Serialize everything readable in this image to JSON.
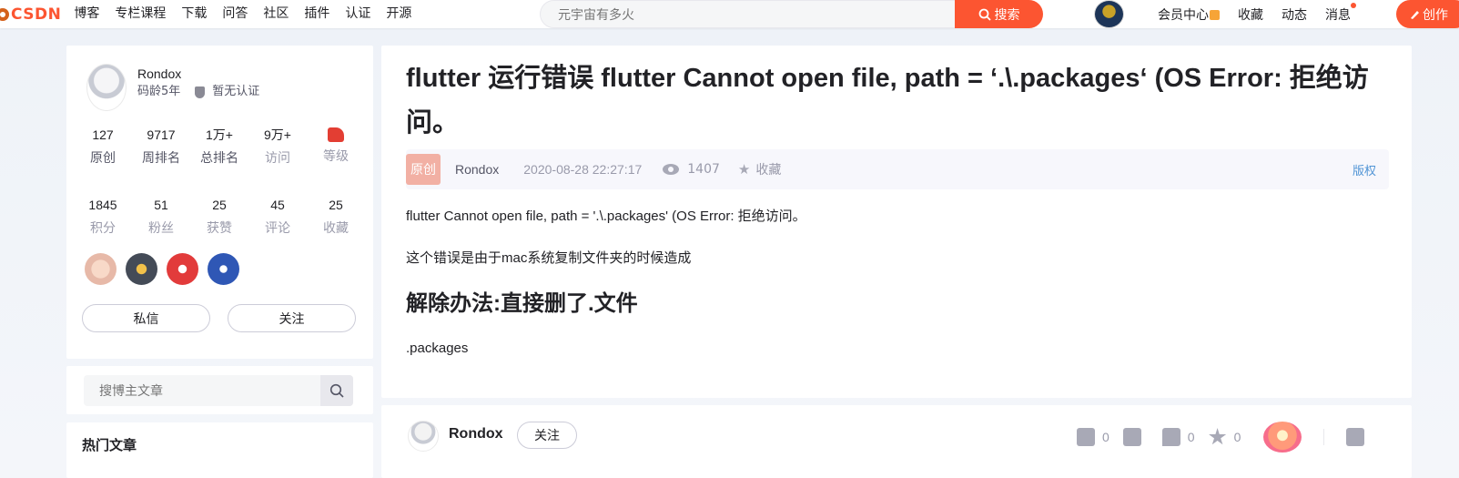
{
  "header": {
    "logo": "CSDN",
    "nav": [
      "博客",
      "专栏课程",
      "下载",
      "问答",
      "社区",
      "插件",
      "认证",
      "开源"
    ],
    "search_placeholder": "元宇宙有多火",
    "search_button": "搜索",
    "right_links": {
      "vip": "会员中心",
      "favorites": "收藏",
      "activity": "动态",
      "messages": "消息"
    },
    "create_button": "创作"
  },
  "profile": {
    "name": "Rondox",
    "age": "码龄5年",
    "cert": "暂无认证",
    "stats_row1": [
      {
        "num": "127",
        "label": "原创"
      },
      {
        "num": "9717",
        "label": "周排名"
      },
      {
        "num": "1万+",
        "label": "总排名"
      },
      {
        "num": "9万+",
        "label": "访问"
      },
      {
        "num": "",
        "label": "等级"
      }
    ],
    "stats_row2": [
      {
        "num": "1845",
        "label": "积分"
      },
      {
        "num": "51",
        "label": "粉丝"
      },
      {
        "num": "25",
        "label": "获赞"
      },
      {
        "num": "45",
        "label": "评论"
      },
      {
        "num": "25",
        "label": "收藏"
      }
    ],
    "message_button": "私信",
    "follow_button": "关注"
  },
  "blog_search": {
    "placeholder": "搜博主文章"
  },
  "hot_articles": {
    "title": "热门文章"
  },
  "article": {
    "title": "flutter 运行错误 flutter Cannot open file, path = ‘.\\.packages‘ (OS Error: 拒绝访问。",
    "tag": "原创",
    "author": "Rondox",
    "date": "2020-08-28 22:27:17",
    "views": "1407",
    "collect": "收藏",
    "copyright": "版权",
    "p1": "flutter Cannot open file, path = '.\\.packages' (OS Error: 拒绝访问。",
    "p2": "这个错误是由于mac系统复制文件夹的时候造成",
    "h2": "解除办法:直接删了.文件",
    "p3": ".packages"
  },
  "footer": {
    "author": "Rondox",
    "follow": "关注",
    "likes": "0",
    "comments": "0",
    "collects": "0"
  },
  "colors": {
    "brand": "#fc5531",
    "link": "#5094d5"
  }
}
